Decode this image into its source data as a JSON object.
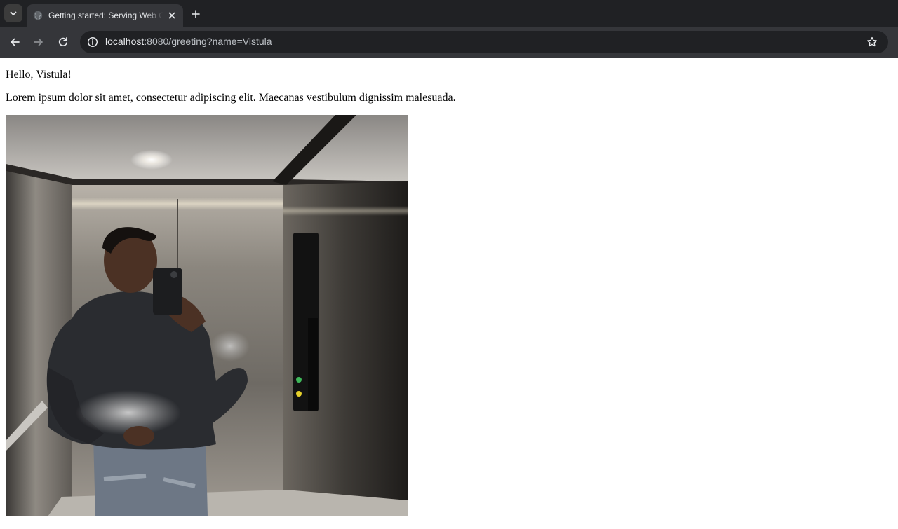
{
  "browser": {
    "tab_title": "Getting started: Serving Web Content",
    "url_host": "localhost",
    "url_rest": ":8080/greeting?name=Vistula"
  },
  "icons": {
    "tab_search": "chevron-down-icon",
    "favicon": "globe-icon",
    "tab_close": "close-icon",
    "new_tab": "plus-icon",
    "back": "arrow-left-icon",
    "forward": "arrow-right-icon",
    "reload": "reload-icon",
    "site_info": "info-icon",
    "bookmark": "star-icon"
  },
  "page": {
    "greeting": "Hello, Vistula!",
    "paragraph": "Lorem ipsum dolor sit amet, consectetur adipiscing elit. Maecanas vestibulum dignissim malesuada."
  }
}
